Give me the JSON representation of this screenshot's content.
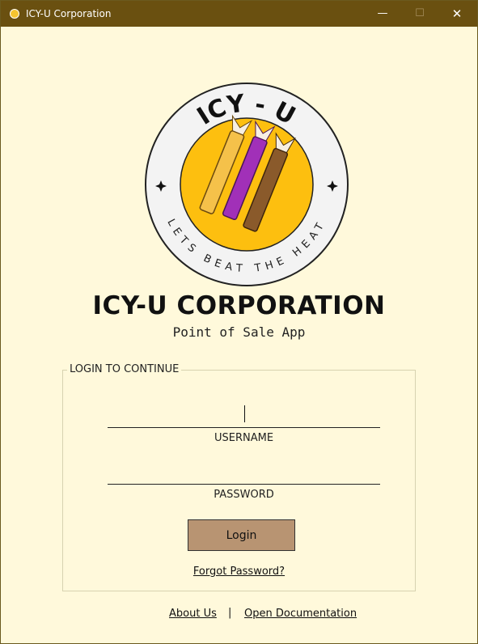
{
  "window": {
    "title": "ICY-U Corporation",
    "controls": {
      "minimize": "—",
      "maximize": "☐",
      "close": "✕"
    }
  },
  "logo": {
    "top_text": "ICY - U",
    "bottom_text": "LETS BEAT THE HEAT"
  },
  "header": {
    "title": "ICY-U CORPORATION",
    "subtitle": "Point of Sale App"
  },
  "login": {
    "legend": "LOGIN TO CONTINUE",
    "username": {
      "value": "",
      "label": "USERNAME"
    },
    "password": {
      "value": "",
      "label": "PASSWORD"
    },
    "button_label": "Login",
    "forgot_label": "Forgot Password?"
  },
  "footer": {
    "about_label": "About Us",
    "separator": "|",
    "docs_label": "Open Documentation"
  },
  "colors": {
    "titlebar": "#6a5010",
    "background": "#fff9db",
    "button": "#b89472",
    "logo_ring": "#f3f3f3",
    "logo_center": "#fdbf0f"
  }
}
